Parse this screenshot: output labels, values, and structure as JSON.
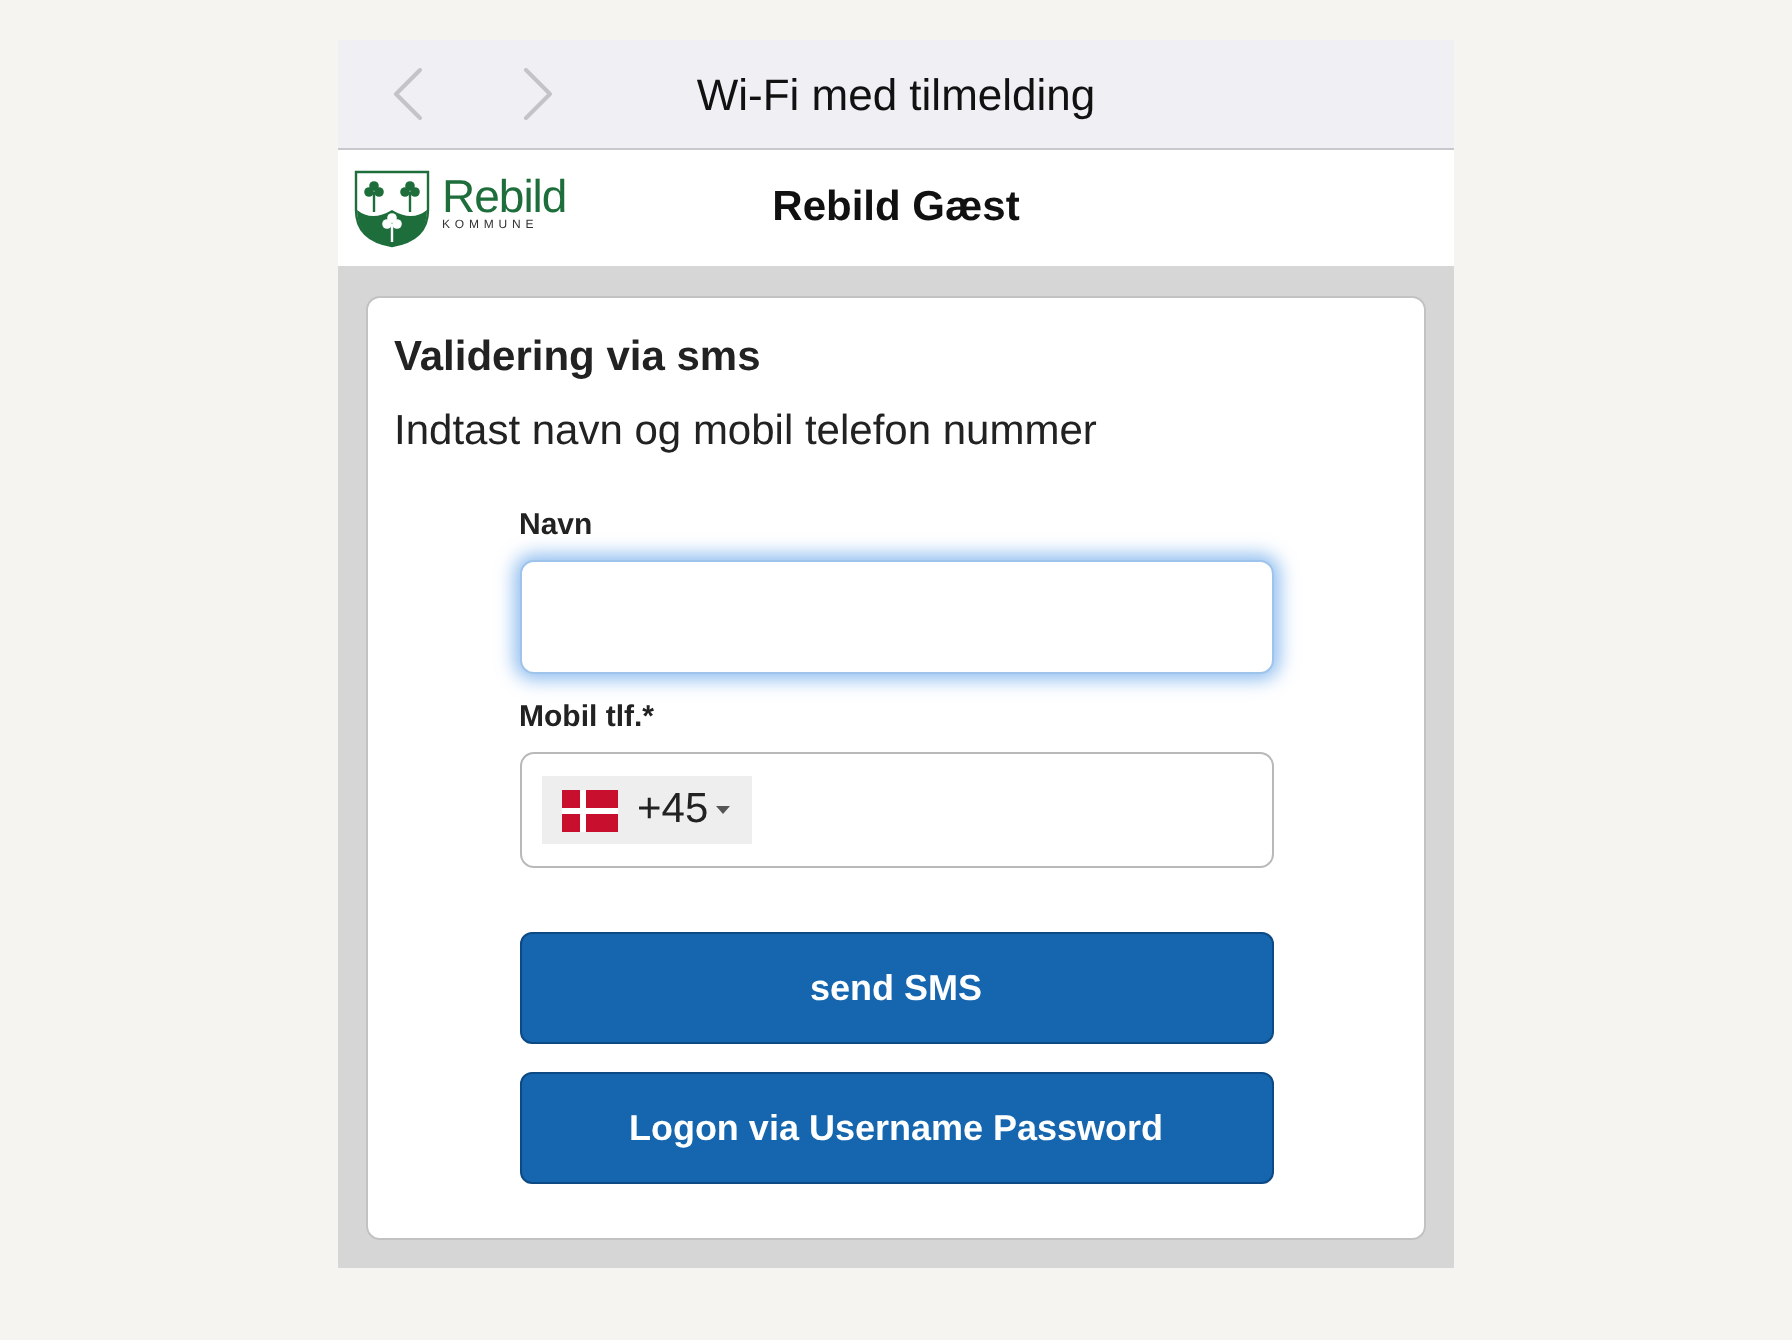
{
  "browser": {
    "nav_buttons": [
      {
        "kind": "back",
        "disabled": true
      },
      {
        "kind": "forward",
        "disabled": true
      }
    ],
    "title": "Wi-Fi med tilmelding"
  },
  "header": {
    "logo_name": "Rebild",
    "logo_subtitle": "KOMMUNE",
    "title": "Rebild Gæst"
  },
  "card": {
    "title": "Validering via sms",
    "subtitle": "Indtast navn og mobil telefon nummer"
  },
  "form": {
    "fields": [
      {
        "kind": "text",
        "label": "Navn",
        "focused": true
      },
      {
        "kind": "phone",
        "label": "Mobil tlf.*",
        "dial_code": "+45",
        "focused": false
      }
    ]
  },
  "buttons": [
    "send SMS",
    "Logon via Username Password"
  ]
}
